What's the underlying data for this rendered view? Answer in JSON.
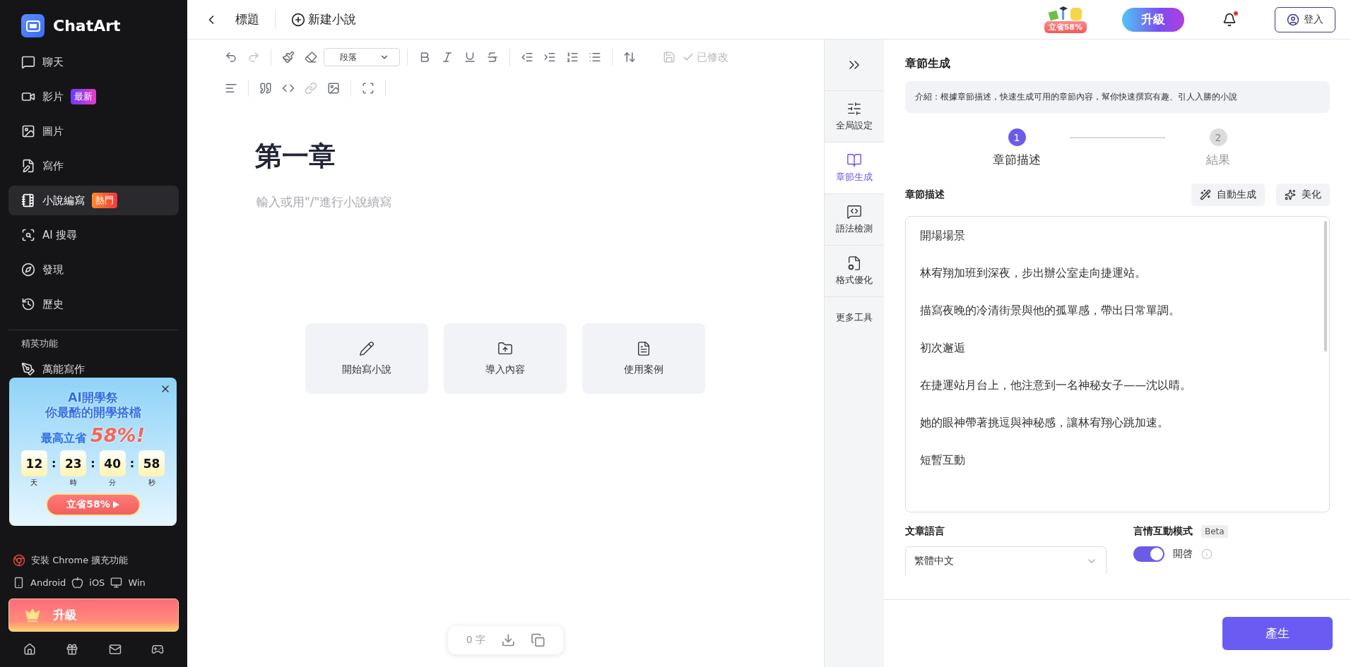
{
  "sidebar": {
    "brand": "ChatArt",
    "items": [
      {
        "label": "聊天",
        "selected": false
      },
      {
        "label": "影片",
        "selected": false,
        "badge": {
          "label": "最新",
          "kind": "new"
        }
      },
      {
        "label": "圖片",
        "selected": false
      },
      {
        "label": "寫作",
        "selected": false
      },
      {
        "label": "小說編寫",
        "selected": true,
        "badge": {
          "label": "熱門",
          "kind": "hot"
        }
      },
      {
        "label": "AI 搜尋",
        "selected": false
      },
      {
        "label": "發現",
        "selected": false
      },
      {
        "label": "歷史",
        "selected": false
      }
    ],
    "section_title": "精英功能",
    "section_items": [
      {
        "label": "萬能寫作",
        "selected": false
      }
    ],
    "promo": {
      "line1": "AI開學祭",
      "line2": "你最酷的開學搭檔",
      "save_prefix": "最高立省",
      "save_value": "58%!",
      "countdown": [
        {
          "value": "12",
          "unit": "天"
        },
        {
          "value": "23",
          "unit": "時"
        },
        {
          "value": "40",
          "unit": "分"
        },
        {
          "value": "58",
          "unit": "秒"
        }
      ],
      "separator": ":",
      "cta": "立省58%"
    },
    "chrome_link": "安裝 Chrome 擴充功能",
    "platforms": [
      "Android",
      "iOS",
      "Win"
    ],
    "upgrade": "升級"
  },
  "topbar": {
    "title": "標題",
    "new_novel": "新建小說",
    "promo_sticker": "立省58%",
    "upgrade": "升級",
    "has_notification": true,
    "login": "登入"
  },
  "editor": {
    "paragraph_select": "段落",
    "save_status": "已修改",
    "heading": "第一章",
    "placeholder": "輸入或用\"/\"進行小說續寫",
    "actions": [
      {
        "label": "開始寫小說"
      },
      {
        "label": "導入內容"
      },
      {
        "label": "使用案例"
      }
    ],
    "word_count": "0 字"
  },
  "tool_rail": [
    {
      "label": "全局設定",
      "selected": false
    },
    {
      "label": "章節生成",
      "selected": true
    },
    {
      "label": "語法檢測",
      "selected": false
    },
    {
      "label": "格式優化",
      "selected": false
    },
    {
      "label": "更多工具",
      "selected": false
    }
  ],
  "panel": {
    "title": "章節生成",
    "intro": "介紹：根據章節描述，快速生成可用的章節內容，幫你快速撰寫有趣、引人入勝的小說",
    "steps": [
      {
        "number": "1",
        "label": "章節描述",
        "selected": true
      },
      {
        "number": "2",
        "label": "結果",
        "selected": false
      }
    ],
    "description_label": "章節描述",
    "auto_generate": "自動生成",
    "beautify": "美化",
    "description": [
      "開場場景",
      "林宥翔加班到深夜，步出辦公室走向捷運站。",
      "描寫夜晚的冷清街景與他的孤單感，帶出日常單調。",
      "初次邂逅",
      "在捷運站月台上，他注意到一名神秘女子——沈以晴。",
      "她的眼神帶著挑逗與神秘感，讓林宥翔心跳加速。",
      "短暫互動"
    ],
    "language_label": "文章語言",
    "language": "繁體中文",
    "mode": {
      "label": "言情互動模式",
      "badge": "Beta",
      "on": true,
      "state_label": "開啓"
    },
    "generate": "產生"
  }
}
